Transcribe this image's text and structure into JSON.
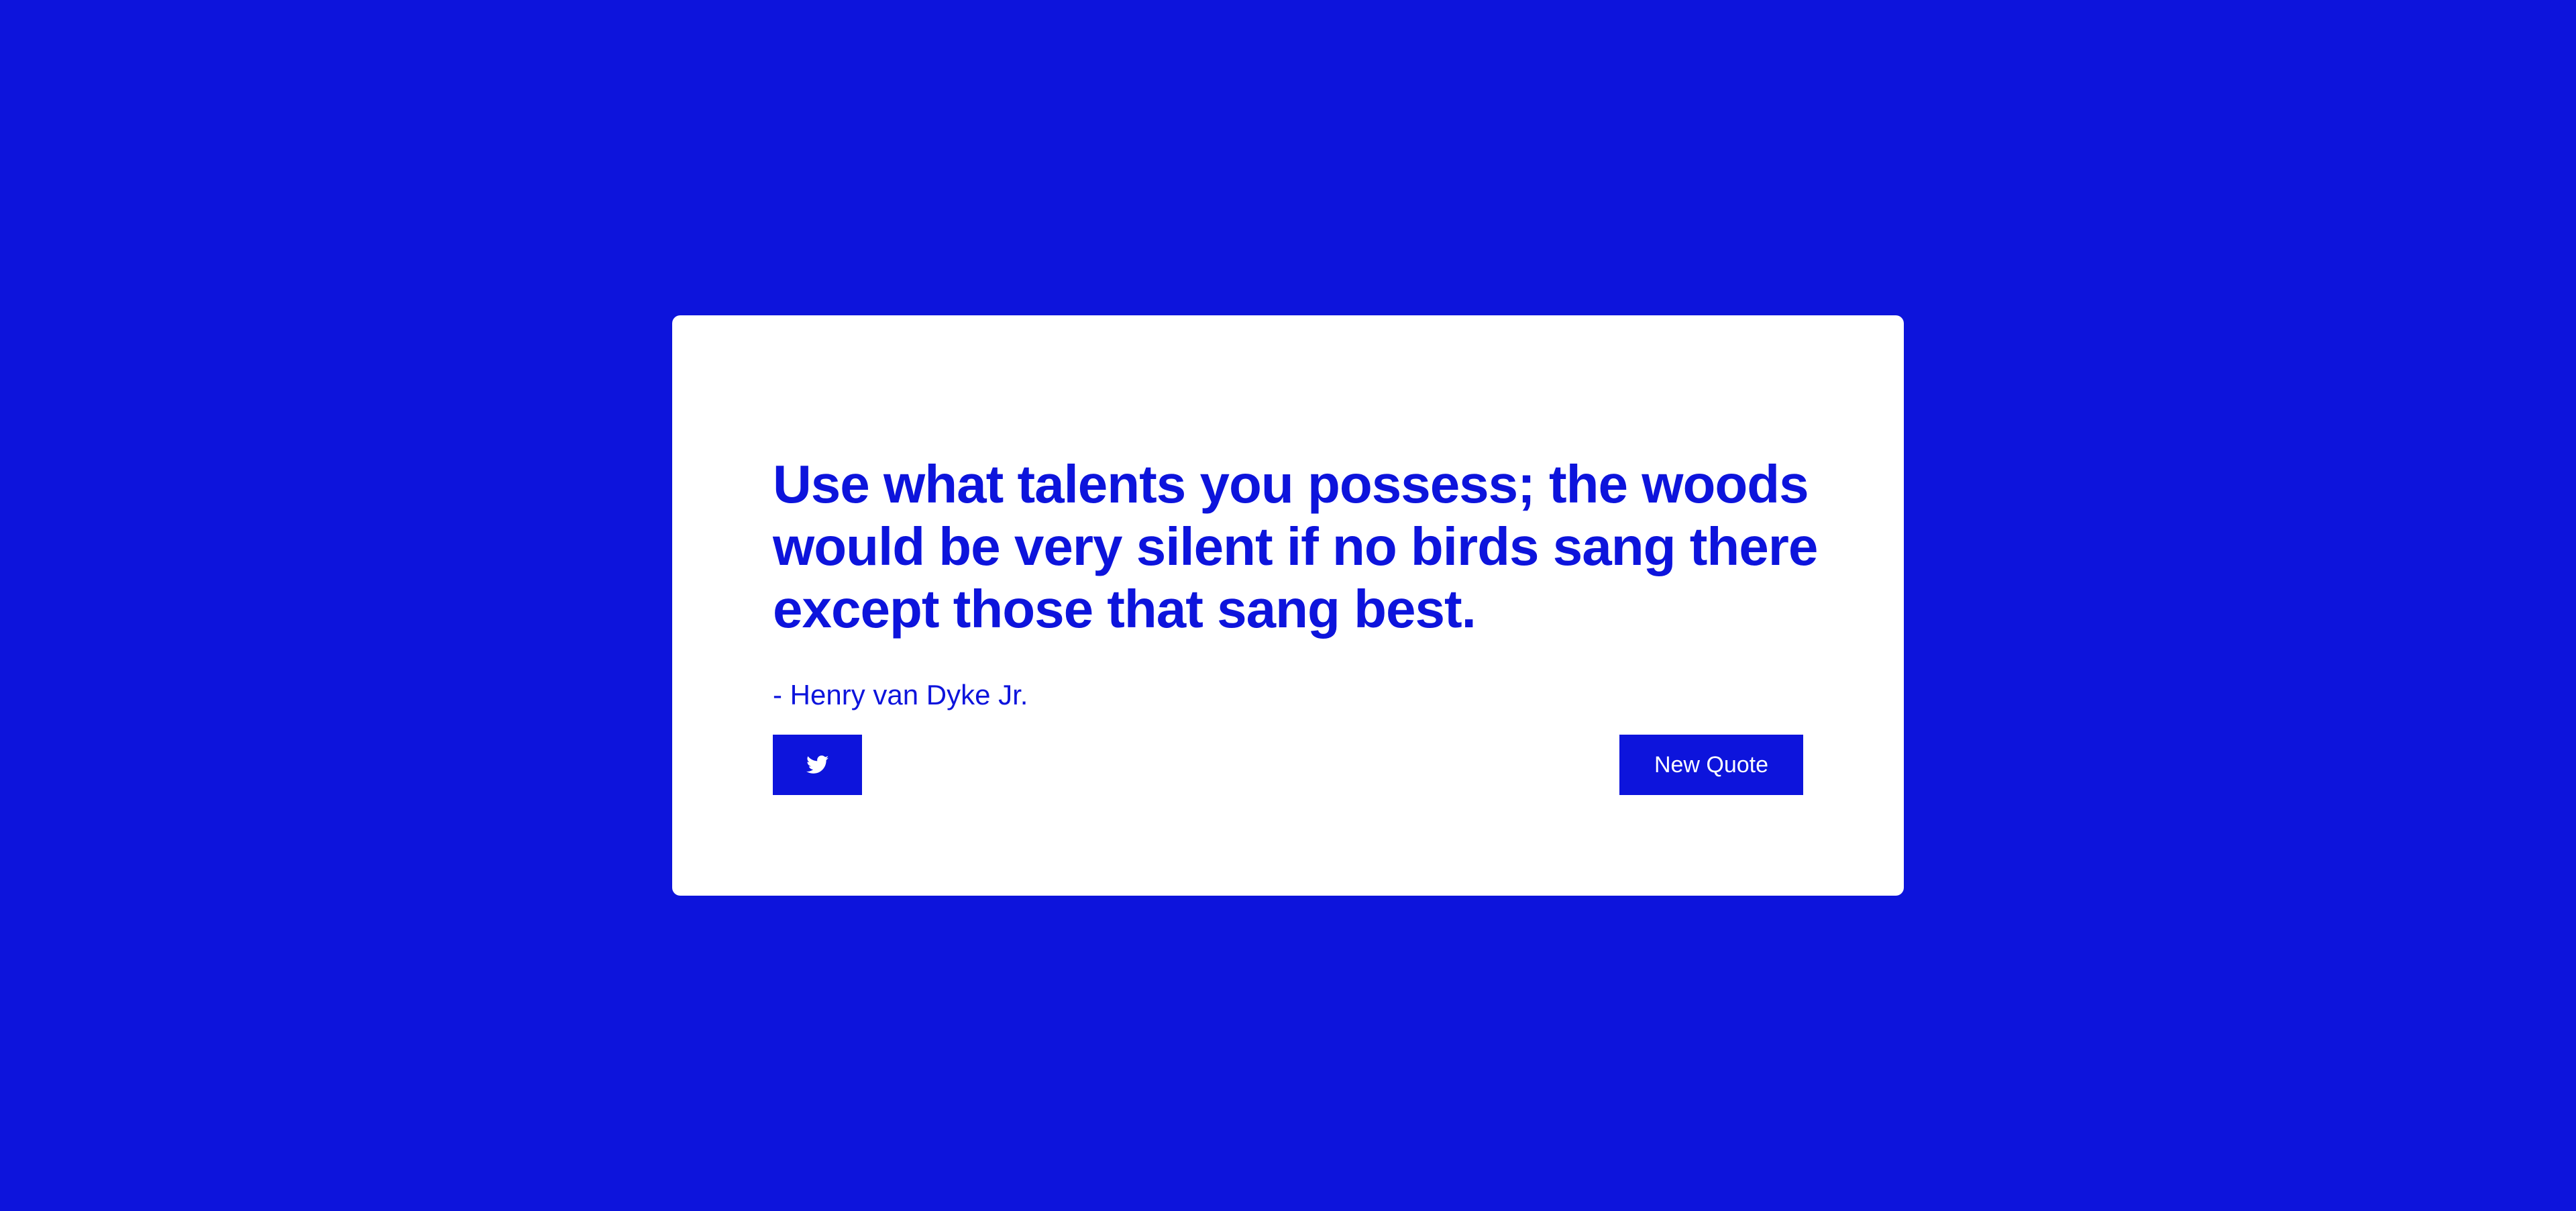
{
  "theme": {
    "accent_color": "#0d14dc",
    "card_color": "#ffffff"
  },
  "quote": {
    "text": "Use what talents you possess; the woods would be very silent if no birds sang there except those that sang best.",
    "author": "- Henry van Dyke Jr."
  },
  "actions": {
    "tweet_icon": "twitter-icon",
    "new_quote_label": "New Quote"
  }
}
